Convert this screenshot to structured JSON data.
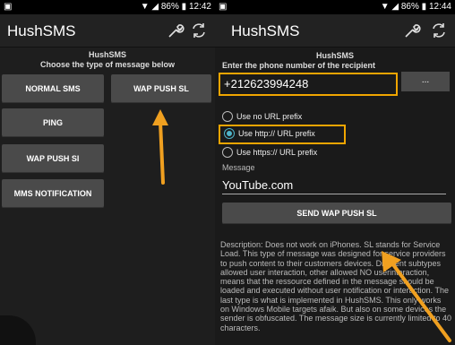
{
  "left_screen": {
    "status": {
      "battery": "86%",
      "time": "12:42"
    },
    "app_title": "HushSMS",
    "header_title": "HushSMS",
    "header_subtitle": "Choose the type of message below",
    "buttons": [
      "NORMAL SMS",
      "WAP PUSH SL",
      "PING",
      "WAP PUSH SI",
      "MMS NOTIFICATION"
    ]
  },
  "right_screen": {
    "status": {
      "battery": "86%",
      "time": "12:44"
    },
    "app_title": "HushSMS",
    "header_title": "HushSMS",
    "header_subtitle": "Enter the phone number of the recipient",
    "phone_value": "+212623994248",
    "contacts_button": "...",
    "radio_options": [
      {
        "label": "Use no URL prefix",
        "selected": false
      },
      {
        "label": "Use http:// URL prefix",
        "selected": true
      },
      {
        "label": "Use https:// URL prefix",
        "selected": false
      }
    ],
    "message_label": "Message",
    "message_value": "YouTube.com",
    "send_button": "SEND WAP PUSH SL",
    "description": "Description: Does not work on iPhones. SL stands for Service Load. This type of message was designed for service providers to push content to their customers devices. Different subtypes allowed user interaction, other allowed NO userinteraction, means that the ressource defined in the message should be loaded and executed without user notification or interaction. The last type is what is implemented in HushSMS. This only works on Windows Mobile targets afaik. But also on some devices the sender is obfuscated. The message size is currently limited to 40 characters."
  },
  "colors": {
    "highlight": "#f0a500",
    "radio_accent": "#4fb5c9",
    "arrow": "#f0a020"
  }
}
